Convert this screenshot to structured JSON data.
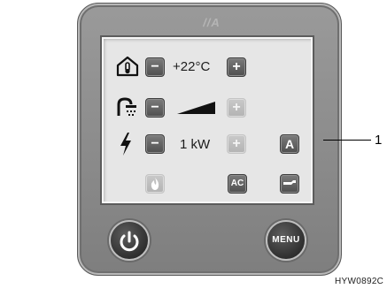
{
  "panel": {
    "brand": "//A"
  },
  "screen": {
    "temperature_row": {
      "icon": "house-thermometer-icon",
      "minus_label": "−",
      "value": "+22°C",
      "plus_label": "+"
    },
    "hot_water_row": {
      "icon": "shower-icon",
      "minus_label": "−",
      "level_icon": "level-ramp-icon",
      "plus_label": "+"
    },
    "power_row": {
      "icon": "lightning-icon",
      "minus_label": "−",
      "value": "1 kW",
      "plus_label": "+",
      "auto_label": "A"
    },
    "bottom_row": {
      "gas_icon": "flame-icon",
      "ac_label": "AC",
      "service_icon": "wrench-icon"
    }
  },
  "controls": {
    "power_icon": "power-icon",
    "menu_label": "MENU"
  },
  "callout": {
    "number": "1"
  },
  "figure_code": "HYW0892C"
}
